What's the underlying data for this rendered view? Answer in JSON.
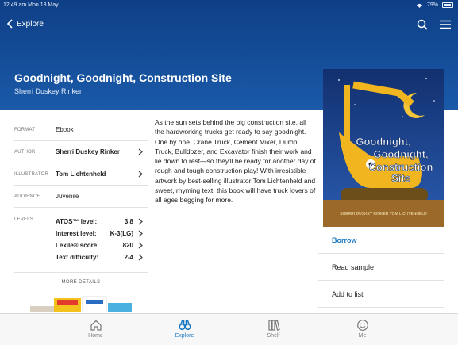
{
  "status": {
    "time": "12:49 am  Mon 13 May",
    "battery": "79%"
  },
  "nav": {
    "back_label": "Explore"
  },
  "book": {
    "title": "Goodnight, Goodnight, Construction Site",
    "author": "Sherri Duskey Rinker",
    "cover": {
      "title_line1": "Goodnight,",
      "title_line2": "Goodnight,",
      "title_line3": "Construction",
      "title_line4": "Site",
      "credits": "SHERRI DUSKEY RINKER  TOM LICHTENHELD"
    },
    "description": "As the sun sets behind the big construction site, all the hardworking trucks get ready to say goodnight. One by one, Crane Truck, Cement Mixer, Dump Truck, Bulldozer, and Excavator finish their work and lie down to rest—so they'll be ready for another day of rough and tough construction play! With irresistible artwork by best-selling illustrator Tom Lichtenheld and sweet, rhyming text, this book will have truck lovers of all ages begging for more."
  },
  "meta": {
    "format_label": "FORMAT",
    "format_value": "Ebook",
    "author_label": "AUTHOR",
    "author_value": "Sherri Duskey Rinker",
    "illustrator_label": "ILLUSTRATOR",
    "illustrator_value": "Tom Lichtenheld",
    "audience_label": "AUDIENCE",
    "audience_value": "Juvenile",
    "levels_label": "LEVELS",
    "levels": [
      {
        "name": "ATOS™ level:",
        "score": "3.8"
      },
      {
        "name": "Interest level:",
        "score": "K-3(LG)"
      },
      {
        "name": "Lexile® score:",
        "score": "820"
      },
      {
        "name": "Text difficulty:",
        "score": "2-4"
      }
    ],
    "more_details": "MORE DETAILS"
  },
  "actions": {
    "borrow": "Borrow",
    "read_sample": "Read sample",
    "add_to_list": "Add to list"
  },
  "tabs": [
    {
      "label": "Home",
      "icon": "home-icon"
    },
    {
      "label": "Explore",
      "icon": "binoculars-icon"
    },
    {
      "label": "Shelf",
      "icon": "books-icon"
    },
    {
      "label": "Me",
      "icon": "smiley-icon"
    }
  ],
  "colors": {
    "header": "#1a5aa9",
    "accent": "#1a78c2"
  }
}
